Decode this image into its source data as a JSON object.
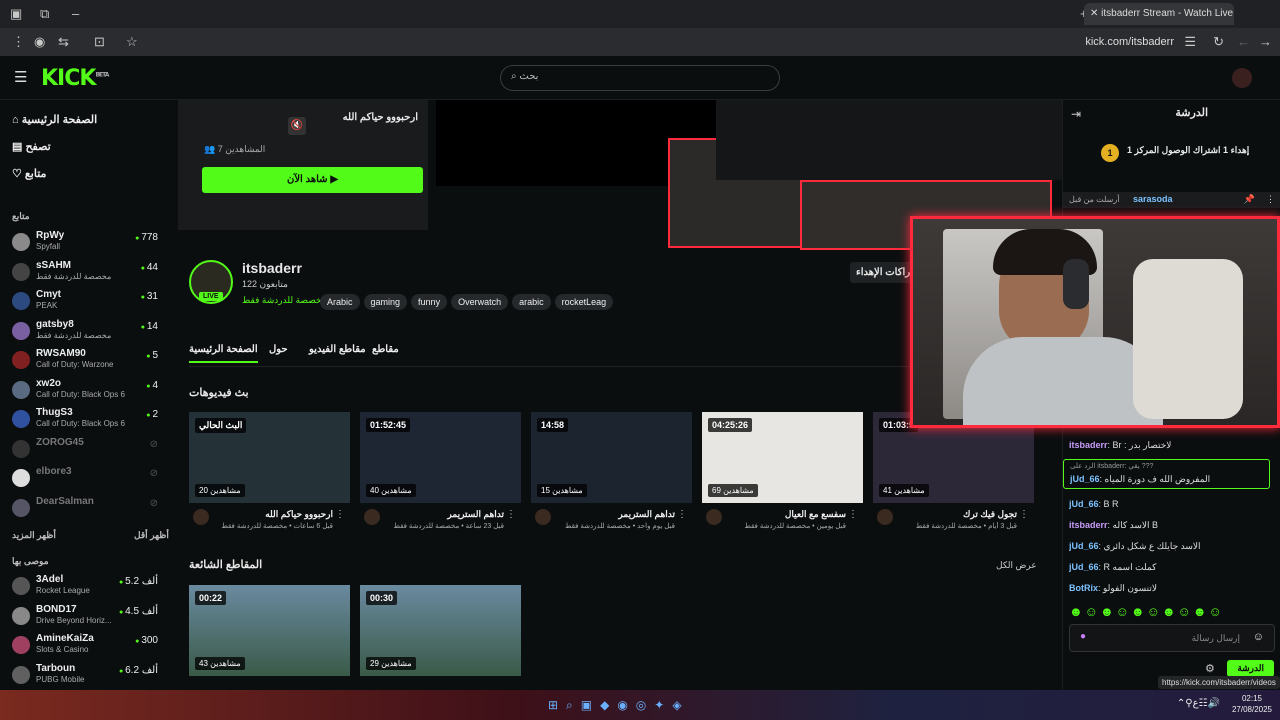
{
  "browser": {
    "tab_title": "itsbaderr Stream - Watch Live o",
    "url": "kick.com/itsbaderr"
  },
  "header": {
    "logo": "KICK",
    "logo_sup": "BETA",
    "search_placeholder": "بحث"
  },
  "sidebar": {
    "nav": [
      {
        "label": "الصفحة الرئيسية",
        "icon": "home-icon"
      },
      {
        "label": "تصفح",
        "icon": "browse-icon"
      },
      {
        "label": "متابع",
        "icon": "heart-icon"
      }
    ],
    "following_title": "متابع",
    "following": [
      {
        "name": "RpWy",
        "sub": "Spyfall",
        "viewers": "778",
        "color": "#8a8a8a"
      },
      {
        "name": "sSAHM",
        "sub": "مخصصة للدردشة فقط",
        "viewers": "44",
        "color": "#444"
      },
      {
        "name": "Cmyt",
        "sub": "PEAK",
        "viewers": "31",
        "color": "#2c4a80"
      },
      {
        "name": "gatsby8",
        "sub": "مخصصة للدردشة فقط",
        "viewers": "14",
        "color": "#7a60a0"
      },
      {
        "name": "RWSAM90",
        "sub": "Call of Duty: Warzone",
        "viewers": "5",
        "color": "#802020"
      },
      {
        "name": "xw2o",
        "sub": "Call of Duty: Black Ops 6",
        "viewers": "4",
        "color": "#5a6a80"
      },
      {
        "name": "ThugS3",
        "sub": "Call of Duty: Black Ops 6",
        "viewers": "2",
        "color": "#3050a0"
      },
      {
        "name": "ZOROG45",
        "sub": "",
        "viewers": "",
        "color": "#333",
        "offline": true
      },
      {
        "name": "elbore3",
        "sub": "",
        "viewers": "",
        "color": "#ddd",
        "offline": true
      },
      {
        "name": "DearSalman",
        "sub": "",
        "viewers": "",
        "color": "#556",
        "offline": true
      }
    ],
    "show_more": "أظهر المزيد",
    "show_less": "أظهر أقل",
    "recommended_title": "موصى بها",
    "recommended": [
      {
        "name": "3Adel",
        "sub": "Rocket League",
        "viewers": "5.2 ألف",
        "color": "#555"
      },
      {
        "name": "BOND17",
        "sub": "Drive Beyond Horiz...",
        "viewers": "4.5 ألف",
        "color": "#888"
      },
      {
        "name": "AmineKaiZa",
        "sub": "Slots & Casino",
        "viewers": "300",
        "color": "#a04060"
      },
      {
        "name": "Tarboun",
        "sub": "PUBG Mobile",
        "viewers": "6.2 ألف",
        "color": "#606060"
      }
    ]
  },
  "offline_card": {
    "title": "ارحبووو حياكم الله",
    "viewers_label": "المشاهدين",
    "viewers": "7",
    "watch_now": "شاهد الآن ▶"
  },
  "channel": {
    "name": "itsbaderr",
    "followers": "122 متابعون",
    "category": "مخصصة للدردشة فقط",
    "live_badge": "LIVE",
    "tags": [
      "Arabic",
      "gaming",
      "funny",
      "Overwatch",
      "arabic",
      "rocketLeag"
    ],
    "subscribe_label": "اشتراكات الإهداء",
    "tabs": [
      "الصفحة الرئيسية",
      "حول",
      "مقاطع الفيديو",
      "مقاطع"
    ]
  },
  "videos_section": {
    "title": "بث فيديوهات",
    "items": [
      {
        "duration": "البث الحالي",
        "views": "20 مشاهدين",
        "title": "ارحبووو حياكم الله",
        "sub": "قبل 6 ساعات • مخصصة للدردشة فقط"
      },
      {
        "duration": "01:52:45",
        "views": "40 مشاهدين",
        "title": "تداهم الستريمر",
        "sub": "قبل 23 ساعة • مخصصة للدردشة فقط"
      },
      {
        "duration": "14:58",
        "views": "15 مشاهدين",
        "title": "تداهم الستريمر",
        "sub": "قبل يوم واحد • مخصصة للدردشة فقط"
      },
      {
        "duration": "04:25:26",
        "views": "69 مشاهدين",
        "title": "سفسع مع العيال",
        "sub": "قبل يومين • مخصصة للدردشة فقط"
      },
      {
        "duration": "01:03:5",
        "views": "41 مشاهدين",
        "title": "تجول فيك ترك",
        "sub": "قبل 3 أيام • مخصصة للدردشة فقط"
      }
    ]
  },
  "clips_section": {
    "title": "المقاطع الشائعة",
    "show_all": "عرض الكل",
    "items": [
      {
        "duration": "00:22",
        "views": "43 مشاهدين"
      },
      {
        "duration": "00:30",
        "views": "29 مشاهدين"
      }
    ]
  },
  "chat": {
    "title": "الدرشة",
    "pinned_title": "إهداء 1 اشتراك الوصول المركز 1",
    "pinned_user": "sarasoda",
    "pinned_note": "أرسلت من قبل",
    "messages": [
      {
        "user": "itsbaderr",
        "text": "Br : لاختصار بدر",
        "purple": true
      },
      {
        "user": "jUd_66",
        "text": "المفروض الله ف دورة المياه",
        "reply": "الرد على itsbaderr: يقي ???"
      },
      {
        "user": "jUd_66",
        "text": "B R"
      },
      {
        "user": "itsbaderr",
        "text": "الاسد كاله B",
        "purple": true
      },
      {
        "user": "jUd_66",
        "text": "الاسد جايلك ع شكل دائري"
      },
      {
        "user": "jUd_66",
        "text": "R كملت اسمه"
      },
      {
        "user": "BotRix",
        "text": "لاتنسون الفولو"
      }
    ],
    "input_placeholder": "إرسال رسالة",
    "send_label": "الدرشة"
  },
  "status_url": "https://kick.com/itsbaderr/videos",
  "taskbar": {
    "time": "02:15",
    "date": "27/08/2025"
  }
}
